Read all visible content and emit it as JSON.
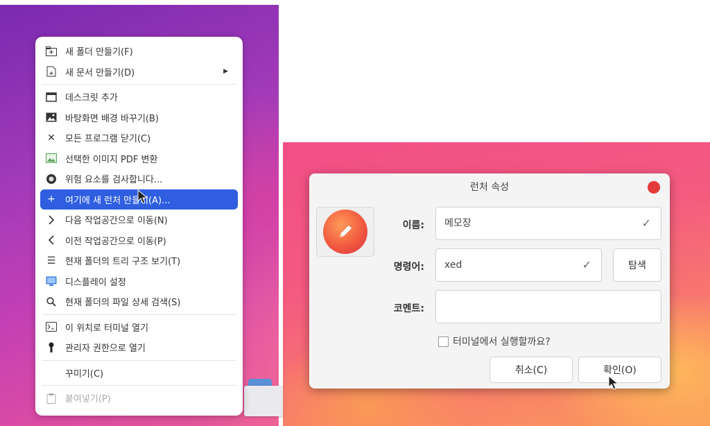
{
  "context_menu": {
    "items": [
      {
        "label": "새 폴더 만들기(F)",
        "icon": "new-folder-icon"
      },
      {
        "label": "새 문서 만들기(D)",
        "icon": "new-document-icon",
        "submenu": true
      },
      {
        "label": "데스크릿 추가",
        "icon": "desklet-icon"
      },
      {
        "label": "바탕화면 배경 바꾸기(B)",
        "icon": "wallpaper-icon"
      },
      {
        "label": "모든 프로그램 닫기(C)",
        "icon": "close-icon"
      },
      {
        "label": "선택한 이미지 PDF 변환",
        "icon": "image-icon"
      },
      {
        "label": "위험 요소를 검사합니다...",
        "icon": "shield-scan-icon"
      },
      {
        "label": "여기에 새 런처 만들기(A)...",
        "icon": "plus-icon",
        "highlighted": true
      },
      {
        "label": "다음 작업공간으로 이동(N)",
        "icon": "chevron-right-icon"
      },
      {
        "label": "이전 작업공간으로 이동(P)",
        "icon": "chevron-left-icon"
      },
      {
        "label": "현재 폴더의 트리 구조 보기(T)",
        "icon": "list-icon"
      },
      {
        "label": "디스플레이 설정",
        "icon": "display-icon"
      },
      {
        "label": "현재 폴더의 파일 상세 검색(S)",
        "icon": "search-icon"
      },
      {
        "label": "이 위치로 터미널 열기",
        "icon": "terminal-icon"
      },
      {
        "label": "관리자 권한으로 열기",
        "icon": "key-icon"
      },
      {
        "label": "꾸미기(C)",
        "icon": ""
      },
      {
        "label": "붙여넣기(P)",
        "icon": "clipboard-icon",
        "disabled": true
      }
    ]
  },
  "dialog": {
    "title": "런처 속성",
    "name_label": "이름:",
    "name_value": "메모장",
    "command_label": "명령어:",
    "command_value": "xed",
    "browse_label": "탐색",
    "comment_label": "코멘트:",
    "comment_value": "",
    "terminal_checkbox_label": "터미널에서 실행할까요?",
    "terminal_checked": false,
    "cancel_label": "취소(C)",
    "ok_label": "확인(O)"
  },
  "colors": {
    "highlight": "#2f5fe0",
    "close_button": "#e33b3b"
  }
}
